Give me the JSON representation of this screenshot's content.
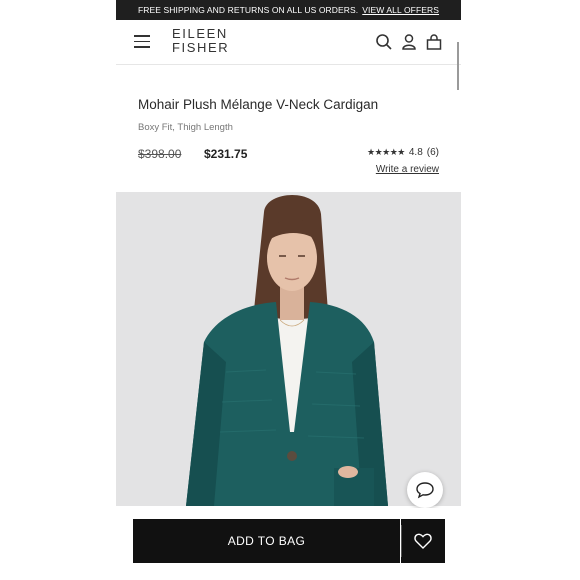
{
  "promo": {
    "text": "FREE SHIPPING AND RETURNS ON ALL US ORDERS.",
    "link": "VIEW ALL OFFERS"
  },
  "header": {
    "logo_line1": "EILEEN",
    "logo_line2": "FISHER",
    "icons": [
      "menu-icon",
      "search-icon",
      "account-icon",
      "bag-icon"
    ]
  },
  "product": {
    "title": "Mohair Plush Mélange V-Neck Cardigan",
    "subtitle": "Boxy Fit, Thigh Length",
    "original_price": "$398.00",
    "sale_price": "$231.75",
    "stars": "★★★★★",
    "rating": "4.8",
    "review_count": "(6)",
    "write_review": "Write a review",
    "image_subject": "woman wearing teal mohair v-neck cardigan over white top"
  },
  "actions": {
    "add_to_bag": "ADD TO BAG"
  },
  "colors": {
    "promo_bg": "#1f1f1f",
    "cta_bg": "#111111",
    "cardigan_teal": "#1d5f5f",
    "photo_bg": "#e3e3e4"
  }
}
